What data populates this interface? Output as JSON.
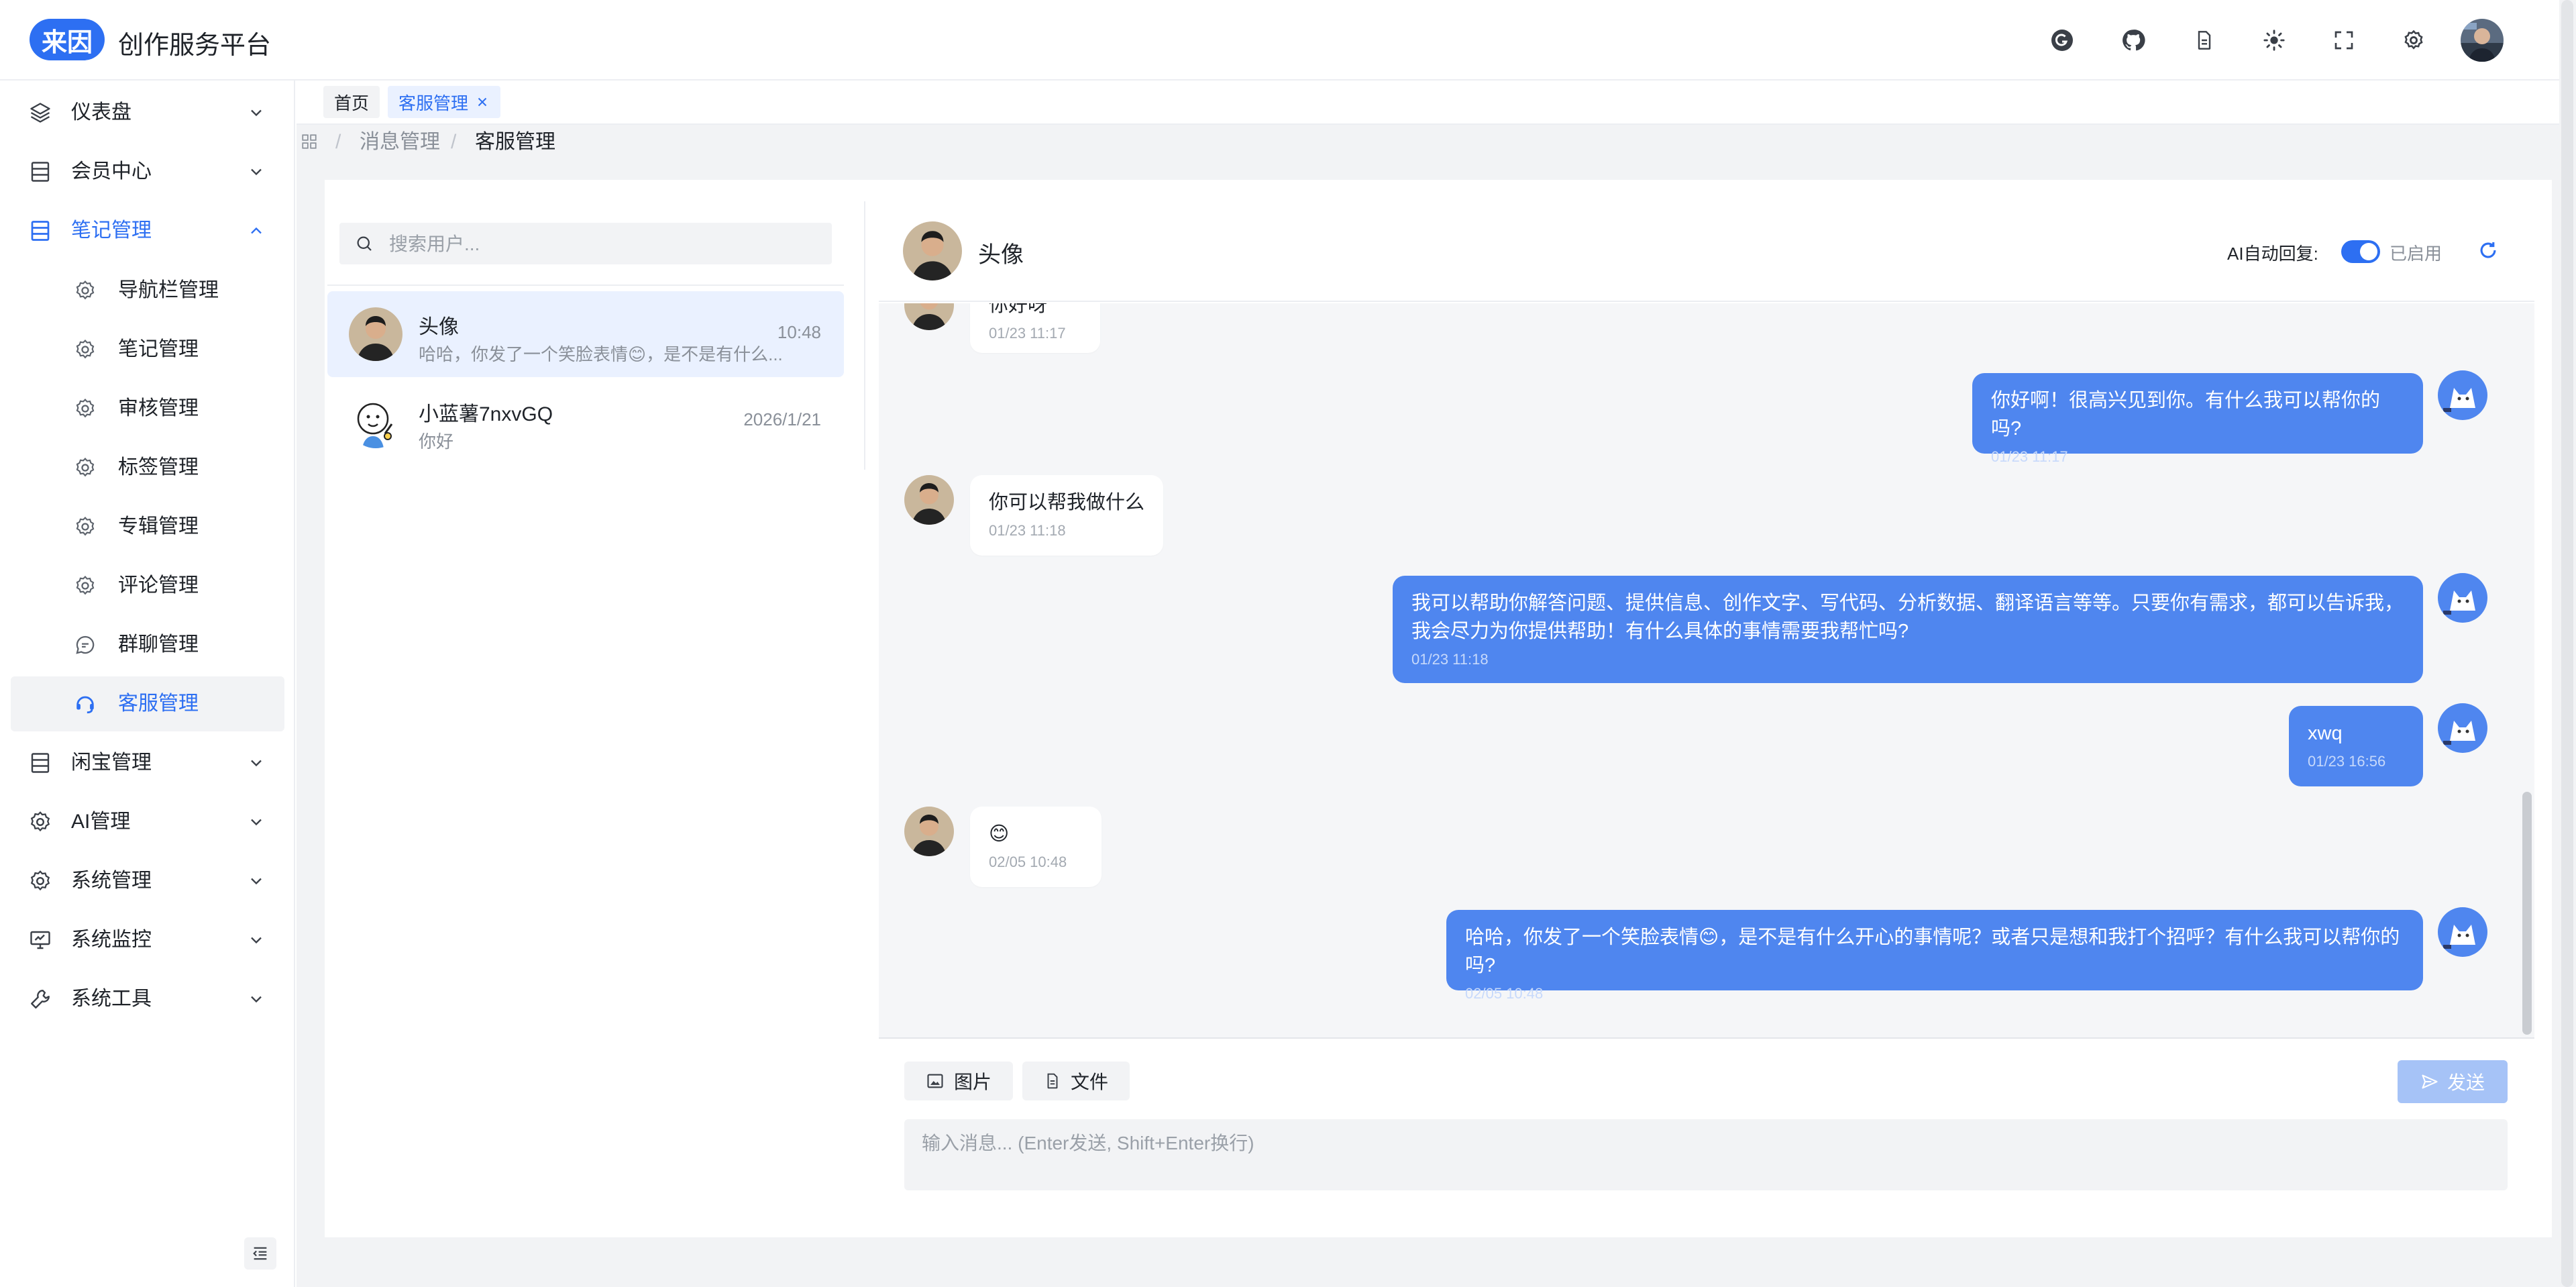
{
  "app": {
    "logo_text": "来因",
    "title": "创作服务平台"
  },
  "header_icons": [
    "translate-icon",
    "github-icon",
    "document-icon",
    "theme-icon",
    "fullscreen-icon",
    "settings-icon"
  ],
  "sidebar": {
    "menus": [
      {
        "label": "仪表盘",
        "icon": "layers-icon"
      },
      {
        "label": "会员中心",
        "icon": "table-icon"
      },
      {
        "label": "笔记管理",
        "icon": "table-icon",
        "expanded": true
      },
      {
        "label": "闲宝管理",
        "icon": "table-icon"
      },
      {
        "label": "AI管理",
        "icon": "gear-icon"
      },
      {
        "label": "系统管理",
        "icon": "gear-icon"
      },
      {
        "label": "系统监控",
        "icon": "monitor-icon"
      },
      {
        "label": "系统工具",
        "icon": "wrench-icon"
      }
    ],
    "sub_items": [
      {
        "label": "导航栏管理",
        "icon": "gear-icon"
      },
      {
        "label": "笔记管理",
        "icon": "gear-icon"
      },
      {
        "label": "审核管理",
        "icon": "gear-icon"
      },
      {
        "label": "标签管理",
        "icon": "gear-icon"
      },
      {
        "label": "专辑管理",
        "icon": "gear-icon"
      },
      {
        "label": "评论管理",
        "icon": "gear-icon"
      },
      {
        "label": "群聊管理",
        "icon": "chat-icon"
      },
      {
        "label": "客服管理",
        "icon": "headset-icon",
        "active": true
      }
    ]
  },
  "tabs": [
    {
      "label": "首页"
    },
    {
      "label": "客服管理",
      "closable": true
    }
  ],
  "breadcrumb": {
    "items": [
      "消息管理",
      "客服管理"
    ],
    "separator": "/"
  },
  "search": {
    "placeholder": "搜索用户..."
  },
  "conversations": [
    {
      "name": "头像",
      "preview": "哈哈，你发了一个笑脸表情😊，是不是有什么...",
      "time": "10:48",
      "active": true
    },
    {
      "name": "小蓝薯7nxvGQ",
      "preview": "你好",
      "time": "2026/1/21"
    }
  ],
  "chat": {
    "contact_name": "头像",
    "ai_reply_label": "AI自动回复:",
    "ai_reply_status": "已启用",
    "ai_reply_enabled": true,
    "messages": [
      {
        "from": "user",
        "text": "你好呀",
        "time": "01/23 11:17"
      },
      {
        "from": "agent",
        "text": "你好啊！很高兴见到你。有什么我可以帮你的吗?",
        "time": "01/23 11:17"
      },
      {
        "from": "user",
        "text": "你可以帮我做什么",
        "time": "01/23 11:18"
      },
      {
        "from": "agent",
        "text": "我可以帮助你解答问题、提供信息、创作文字、写代码、分析数据、翻译语言等等。只要你有需求，都可以告诉我，我会尽力为你提供帮助！有什么具体的事情需要我帮忙吗?",
        "time": "01/23 11:18"
      },
      {
        "from": "agent",
        "text": "xwq",
        "time": "01/23 16:56"
      },
      {
        "from": "user",
        "text": "😊",
        "time": "02/05 10:48"
      },
      {
        "from": "agent",
        "text": "哈哈，你发了一个笑脸表情😊，是不是有什么开心的事情呢？或者只是想和我打个招呼？有什么我可以帮你的吗?",
        "time": "02/05 10:48"
      }
    ]
  },
  "composer": {
    "image_label": "图片",
    "file_label": "文件",
    "send_label": "发送",
    "placeholder": "输入消息... (Enter发送, Shift+Enter换行)"
  },
  "colors": {
    "accent": "#2d6ff2",
    "agent_bubble": "#4f86ef",
    "user_bubble": "#ffffff",
    "chat_bg": "#f5f6f8"
  }
}
